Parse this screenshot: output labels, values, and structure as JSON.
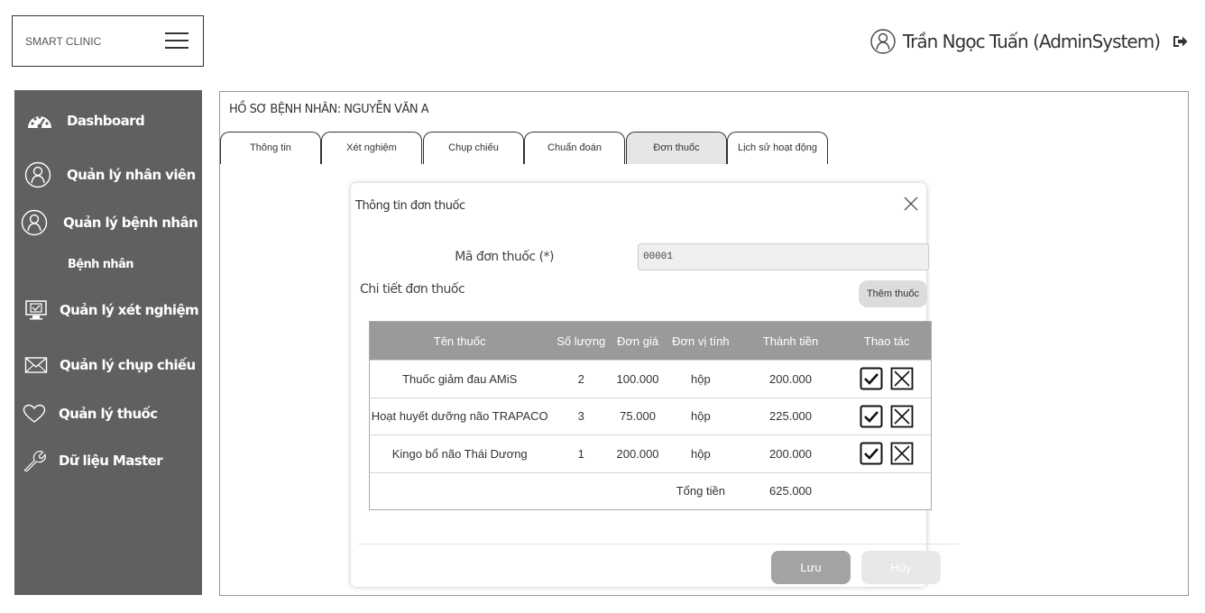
{
  "brand": {
    "name": "SMART CLINIC"
  },
  "user": {
    "display_name": "Trần Ngọc Tuấn (AdminSystem)"
  },
  "sidebar": {
    "items": [
      {
        "label": "Dashboard",
        "icon": "dashboard-icon"
      },
      {
        "label": "Quản lý nhân viên",
        "icon": "user-icon"
      },
      {
        "label": "Quản lý bệnh nhân",
        "icon": "user-icon"
      },
      {
        "label": "Bệnh nhân",
        "icon": ""
      },
      {
        "label": "Quản lý xét nghiệm",
        "icon": "monitor-check-icon"
      },
      {
        "label": "Quản lý chụp chiếu",
        "icon": "envelope-icon"
      },
      {
        "label": "Quản lý thuốc",
        "icon": "heart-icon"
      },
      {
        "label": "Dữ liệu Master",
        "icon": "wrench-icon"
      }
    ]
  },
  "record": {
    "title": "HỒ SƠ BỆNH NHÂN: NGUYỄN VĂN A"
  },
  "tabs": [
    {
      "label": "Thông tin"
    },
    {
      "label": "Xét nghiệm"
    },
    {
      "label": "Chụp chiếu"
    },
    {
      "label": "Chuẩn đoán"
    },
    {
      "label": "Đơn thuốc",
      "active": true
    },
    {
      "label": "Lịch sử hoạt động"
    }
  ],
  "modal": {
    "title": "Thông tin đơn thuốc",
    "code_label": "Mã đơn thuốc (*)",
    "code_value": "00001",
    "detail_label": "Chi tiết đơn thuốc",
    "add_button": "Thêm thuốc",
    "table": {
      "headers": [
        "Tên thuốc",
        "Số lượng",
        "Đơn giá",
        "Đơn vị tính",
        "Thành tiền",
        "Thao tác"
      ],
      "rows": [
        {
          "name": "Thuốc giảm đau AMiS",
          "qty": "2",
          "price": "100.000",
          "unit": "hộp",
          "total": "200.000"
        },
        {
          "name": "Hoạt huyết dưỡng não TRAPACO",
          "qty": "3",
          "price": "75.000",
          "unit": "hộp",
          "total": "225.000"
        },
        {
          "name": "Kingo bổ não Thái Dương",
          "qty": "1",
          "price": "200.000",
          "unit": "hộp",
          "total": "200.000"
        }
      ],
      "total_label": "Tổng tiền",
      "total_value": "625.000"
    },
    "save_button": "Lưu",
    "cancel_button": "Hủy"
  },
  "colors": {
    "sidebar_bg": "#606060",
    "table_header_bg": "#9a9a9a",
    "active_tab_bg": "#e6e6e6"
  }
}
